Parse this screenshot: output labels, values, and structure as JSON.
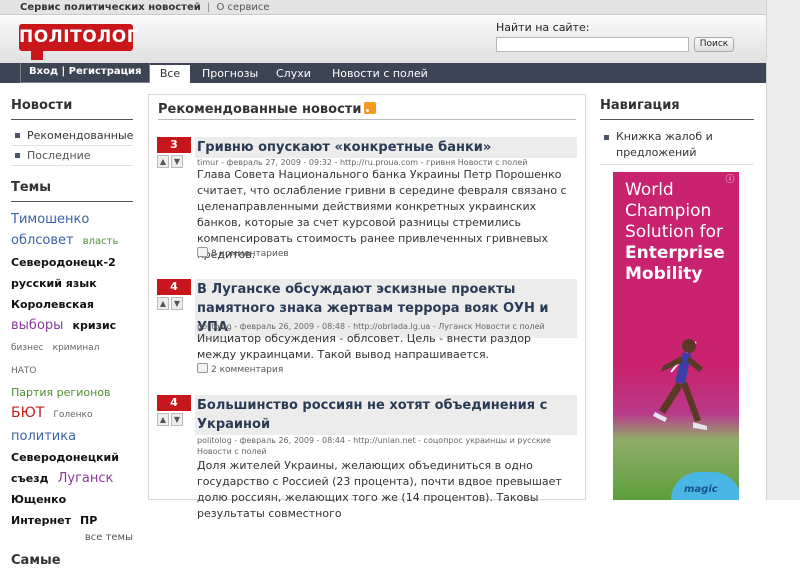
{
  "topbar": {
    "site_name": "Сервис политических новостей",
    "separator": "|",
    "about_link": "О сервисе"
  },
  "header": {
    "logo_text": "ПОЛІТОЛОГ",
    "search": {
      "label": "Найти на сайте:",
      "value": "",
      "placeholder": "",
      "button": "Поиск"
    }
  },
  "nav": {
    "login": "Вход | Регистрация",
    "tabs": [
      "Все",
      "Прогнозы",
      "Слухи",
      "Новости с полей"
    ],
    "active_tab": "Все"
  },
  "left": {
    "news_heading": "Новости",
    "news_items": [
      "Рекомендованные",
      "Последние"
    ],
    "topics_heading": "Темы",
    "tags": [
      {
        "text": "Тимошенко",
        "style": "t-blue",
        "size": 13
      },
      {
        "text": "облсовет",
        "style": "t-blue",
        "size": 13
      },
      {
        "text": "власть",
        "style": "t-green",
        "size": 10
      },
      {
        "text": "Северодонецк-2",
        "style": "t-black",
        "size": 11
      },
      {
        "text": "русский язык",
        "style": "t-black",
        "size": 11
      },
      {
        "text": "Королевская",
        "style": "t-black",
        "size": 11
      },
      {
        "text": "выборы",
        "style": "t-purple",
        "size": 13
      },
      {
        "text": "кризис",
        "style": "t-black",
        "size": 11
      },
      {
        "text": "бизнес",
        "style": "t-gray",
        "size": 9
      },
      {
        "text": "криминал",
        "style": "t-gray",
        "size": 9
      },
      {
        "text": "НАТО",
        "style": "t-gray",
        "size": 9
      },
      {
        "text": "Партия регионов",
        "style": "t-green",
        "size": 11
      },
      {
        "text": "БЮТ",
        "style": "t-red",
        "size": 14
      },
      {
        "text": "Голенко",
        "style": "t-gray",
        "size": 9
      },
      {
        "text": "политика",
        "style": "t-blue",
        "size": 13
      },
      {
        "text": "Северодонецкий",
        "style": "t-black",
        "size": 11
      },
      {
        "text": "съезд",
        "style": "t-black",
        "size": 11
      },
      {
        "text": "Луганск",
        "style": "t-purple",
        "size": 13
      },
      {
        "text": "Ющенко",
        "style": "t-black",
        "size": 11
      },
      {
        "text": "Интернет",
        "style": "t-black",
        "size": 11
      },
      {
        "text": "ПР",
        "style": "t-black",
        "size": 11
      }
    ],
    "all_tags": "все темы",
    "bottom_heading": "Самые"
  },
  "center": {
    "heading": "Рекомендованные новости",
    "news": [
      {
        "votes": "3",
        "title": "Гривню опускают «конкретные банки»",
        "meta": "timur - февраль 27, 2009 - 09:32 - http://ru.proua.com - гривня Новости с полей",
        "meta2": "",
        "text": "Глава Совета Национального банка Украины Петр Порошенко считает, что ослабление гривни в середине февраля связано с целенаправленными действиями конкретных украинских банков, которые за счет курсовой разницы стремились компенсировать стоимость ранее привлеченных гривневых кредитов.",
        "comments": "8 комментариев"
      },
      {
        "votes": "4",
        "title": "В Луганске обсуждают эскизные проекты памятного знака жертвам террора вояк ОУН и УПА",
        "meta": "politolog - февраль 26, 2009 - 08:48 - http://obrlada.lg.ua - Луганск Новости с полей",
        "meta2": "",
        "text": "Инициатор обсуждения - облсовет. Цель - внести раздор между украинцами. Такой вывод напрашивается.",
        "comments": "2 комментария"
      },
      {
        "votes": "4",
        "title": "Большинство россиян не хотят объединения с Украиной",
        "meta": "politolog - февраль 26, 2009 - 08:44 - http://unian.net - соцопрос украинцы и русские",
        "meta2": "Новости с полей",
        "text": "Доля жителей Украины, желающих объединиться в одно государство с Россией (23 процента), почти вдвое превышает долю россиян, желающих того же (14 процентов). Таковы результаты совместного",
        "comments": ""
      }
    ]
  },
  "right": {
    "nav_heading": "Навигация",
    "nav_items": [
      "Книжка жалоб и предложений"
    ],
    "ad": {
      "line1": "World",
      "line2": "Champion",
      "line3": "Solution for",
      "line4": "Enterprise",
      "line5": "Mobility",
      "brand": "magic",
      "badge": "ⓘ"
    }
  },
  "colors": {
    "brand_red": "#c9161b",
    "navbar": "#3c4554",
    "link_title": "#2a3b55"
  }
}
